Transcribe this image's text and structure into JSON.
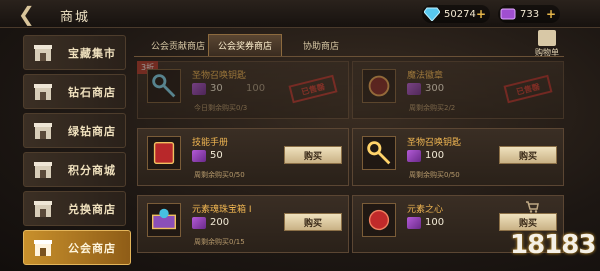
{
  "header": {
    "title": "商城",
    "resources": [
      {
        "name": "diamond",
        "value": "50274"
      },
      {
        "name": "guild-ticket",
        "value": "733"
      }
    ]
  },
  "sidebar": {
    "items": [
      {
        "label": "宝藏集市",
        "active": false
      },
      {
        "label": "钻石商店",
        "active": false
      },
      {
        "label": "绿钻商店",
        "active": false
      },
      {
        "label": "积分商城",
        "active": false
      },
      {
        "label": "兑换商店",
        "active": false
      },
      {
        "label": "公会商店",
        "active": true
      }
    ]
  },
  "tabs": [
    {
      "label": "公会贡献商店",
      "active": false
    },
    {
      "label": "公会奖券商店",
      "active": true
    },
    {
      "label": "协助商店",
      "active": false
    }
  ],
  "buylist": {
    "label": "购物单"
  },
  "cards": [
    {
      "name": "圣物召唤钥匙",
      "price": "30",
      "price2": "100",
      "limit": "今日剩余购买0/3",
      "soldout": true,
      "stamp": "已售罄",
      "discount": "3折",
      "button": ""
    },
    {
      "name": "魔法徽章",
      "price": "300",
      "price2": "",
      "limit": "周剩余购买2/2",
      "soldout": true,
      "stamp": "已售罄",
      "discount": "",
      "button": ""
    },
    {
      "name": "技能手册",
      "price": "50",
      "price2": "",
      "limit": "周剩余购买0/50",
      "soldout": false,
      "stamp": "",
      "discount": "",
      "button": "购买"
    },
    {
      "name": "圣物召唤钥匙",
      "price": "100",
      "price2": "",
      "limit": "周剩余购买0/50",
      "soldout": false,
      "stamp": "",
      "discount": "",
      "button": "购买"
    },
    {
      "name": "元素魂珠宝箱 I",
      "price": "200",
      "price2": "",
      "limit": "周剩余购买0/15",
      "soldout": false,
      "stamp": "",
      "discount": "",
      "button": "购买"
    },
    {
      "name": "元素之心",
      "price": "100",
      "price2": "",
      "limit": "",
      "soldout": false,
      "stamp": "",
      "discount": "",
      "button": "购买"
    }
  ],
  "watermark": {
    "text": "18183"
  },
  "colors": {
    "accent": "#f0b652",
    "active_tab": "#c8902c",
    "stamp": "#c0382e"
  }
}
